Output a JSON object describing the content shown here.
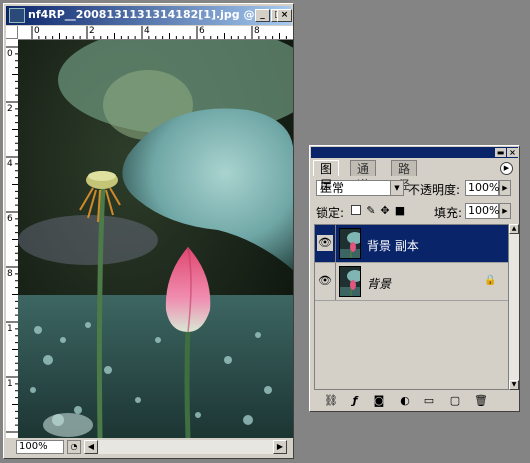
{
  "document": {
    "title": "nf4RP__2008131131314182[1].jpg @ ...",
    "window_buttons": {
      "minimize": "_",
      "maximize": "□",
      "close": "×"
    },
    "ruler_top_labels": [
      "0",
      "2",
      "4",
      "6",
      "8"
    ],
    "ruler_left_labels": [
      "0",
      "2",
      "4",
      "6",
      "8",
      "1",
      "1"
    ],
    "zoom": "100%"
  },
  "layers_panel": {
    "tabs": [
      "图层",
      "通道",
      "路径"
    ],
    "active_tab": "图层",
    "blend_mode": "正常",
    "opacity_label": "不透明度:",
    "opacity_value": "100%",
    "lock_label": "锁定:",
    "fill_label": "填充:",
    "fill_value": "100%",
    "layers": [
      {
        "name": "背景 副本",
        "selected": true,
        "visible": true
      },
      {
        "name": "背景",
        "selected": false,
        "visible": true,
        "locked": true
      }
    ],
    "bottom_icons": [
      "link-icon",
      "layer-style-icon",
      "mask-icon",
      "adjustment-layer-icon",
      "new-group-icon",
      "new-layer-icon",
      "trash-icon"
    ]
  },
  "colors": {
    "titlebar_start": "#0a246a",
    "titlebar_end": "#a6caf0",
    "selection": "#0a246a",
    "workspace": "#848484"
  }
}
